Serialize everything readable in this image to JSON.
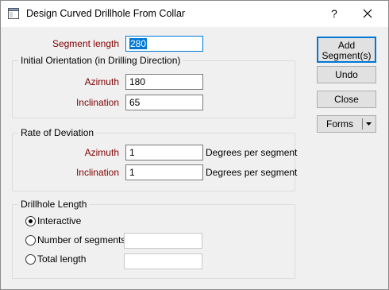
{
  "window": {
    "title": "Design Curved Drillhole From Collar",
    "help_glyph": "?",
    "icon": "window-app-icon"
  },
  "segment": {
    "label": "Segment length",
    "value": "280"
  },
  "initial_orientation": {
    "title": "Initial Orientation (in Drilling Direction)",
    "azimuth_label": "Azimuth",
    "azimuth_value": "180",
    "inclination_label": "Inclination",
    "inclination_value": "65"
  },
  "rate_of_deviation": {
    "title": "Rate of Deviation",
    "azimuth_label": "Azimuth",
    "azimuth_value": "1",
    "azimuth_unit": "Degrees per segment",
    "inclination_label": "Inclination",
    "inclination_value": "1",
    "inclination_unit": "Degrees per segment"
  },
  "drillhole_length": {
    "title": "Drillhole Length",
    "options": [
      "Interactive",
      "Number of segments",
      "Total length"
    ],
    "selected": "Interactive",
    "number_of_segments_value": "",
    "total_length_value": ""
  },
  "buttons": {
    "add_segments": [
      "Add",
      "Segment(s)"
    ],
    "undo": "Undo",
    "close": "Close",
    "forms": "Forms"
  },
  "colors": {
    "accent": "#0078d7",
    "label_red": "#800000"
  }
}
